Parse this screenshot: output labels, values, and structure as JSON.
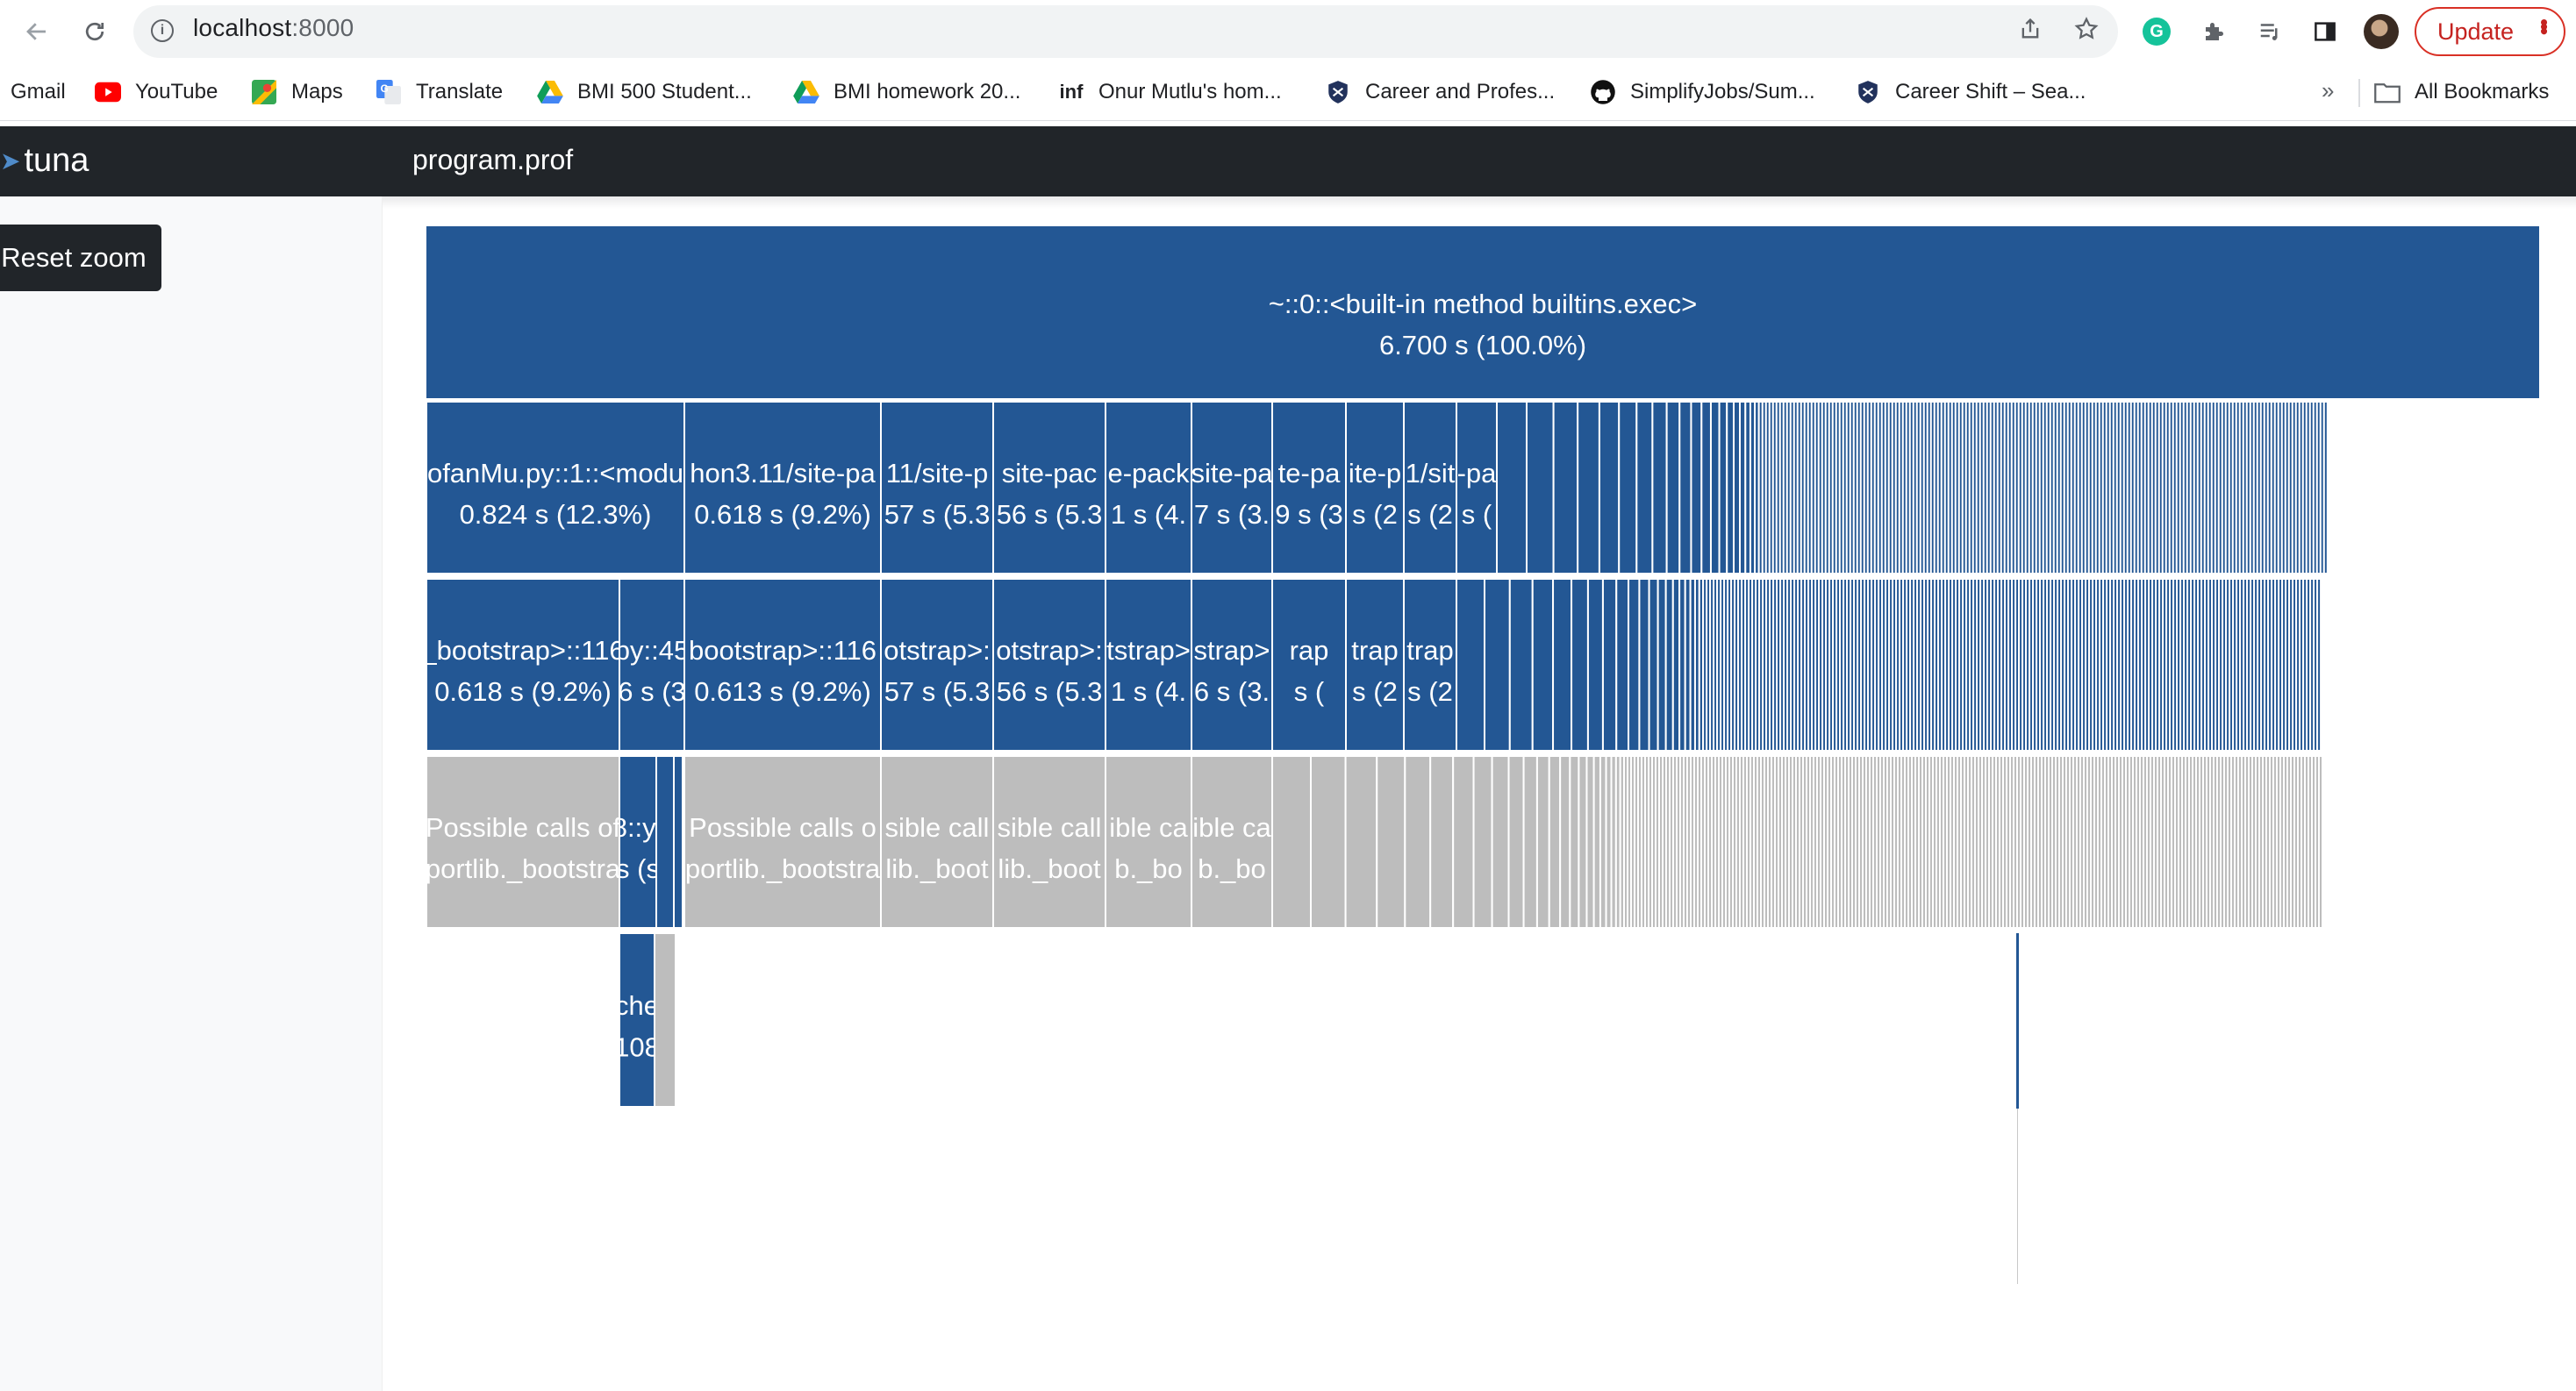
{
  "browser": {
    "url_host": "localhost",
    "url_port": ":8000",
    "update_label": "Update",
    "bookmarks": [
      {
        "label": "Gmail",
        "icon": "gmail-icon"
      },
      {
        "label": "YouTube",
        "icon": "youtube-icon"
      },
      {
        "label": "Maps",
        "icon": "maps-icon"
      },
      {
        "label": "Translate",
        "icon": "translate-icon"
      },
      {
        "label": "BMI 500 Student...",
        "icon": "google-drive-icon"
      },
      {
        "label": "BMI homework 20...",
        "icon": "google-drive-icon"
      },
      {
        "label": "Onur Mutlu's hom...",
        "icon": "inf-icon"
      },
      {
        "label": "Career and Profes...",
        "icon": "shield-icon"
      },
      {
        "label": "SimplifyJobs/Sum...",
        "icon": "github-icon"
      },
      {
        "label": "Career Shift – Sea...",
        "icon": "shield-icon"
      }
    ],
    "all_bookmarks_label": "All Bookmarks"
  },
  "app": {
    "name": "tuna",
    "file": "program.prof",
    "reset_zoom_label": "Reset zoom"
  },
  "colors": {
    "block": "#235794",
    "no_data": "#bdbdbd",
    "header": "#212529"
  },
  "flame": {
    "root": {
      "name": "~::0::<built-in method builtins.exec>",
      "stat": "6.700 s (100.0%)"
    },
    "level1": [
      {
        "name": "ofanMu.py::1::<modu",
        "stat": "0.824 s (12.3%)"
      },
      {
        "name": "hon3.11/site-pa",
        "stat": "0.618 s (9.2%)"
      },
      {
        "name": "11/site-p",
        "stat": "57 s (5.3"
      },
      {
        "name": "site-pac",
        "stat": "56 s (5.3"
      },
      {
        "name": "e-pack",
        "stat": "1 s (4."
      },
      {
        "name": "site-pa",
        "stat": "7 s (3."
      },
      {
        "name": "te-pa",
        "stat": "9 s (3"
      },
      {
        "name": "ite-p",
        "stat": "s (2"
      },
      {
        "name": "1/sit",
        "stat": "s (2"
      },
      {
        "name": "-pa",
        "stat": "s ("
      }
    ],
    "level2": [
      {
        "name": "_bootstrap>::116",
        "stat": "0.618 s (9.2%)"
      },
      {
        "name": "py::45",
        "stat": "6 s (3"
      },
      {
        "name": "bootstrap>::116",
        "stat": "0.613 s (9.2%)"
      },
      {
        "name": "otstrap>:",
        "stat": "57 s (5.3"
      },
      {
        "name": "otstrap>:",
        "stat": "56 s (5.3"
      },
      {
        "name": "tstrap>",
        "stat": "1 s (4."
      },
      {
        "name": "strap>",
        "stat": "6 s (3."
      },
      {
        "name": "rap",
        "stat": "s ("
      },
      {
        "name": "trap",
        "stat": "s (2"
      },
      {
        "name": "trap",
        "stat": "s (2"
      }
    ],
    "level3": [
      {
        "name": "Possible calls of",
        "stat": "portlib._bootstra"
      },
      {
        "name": "8::yt",
        "stat": "s (s"
      },
      {
        "name": "Possible calls o",
        "stat": "portlib._bootstra"
      },
      {
        "name": "sible call",
        "stat": "lib._boot"
      },
      {
        "name": "sible call",
        "stat": "lib._boot"
      },
      {
        "name": "ible ca",
        "stat": "b._bo"
      },
      {
        "name": "ible ca",
        "stat": "b._bo"
      }
    ],
    "level4": [
      {
        "name": "che",
        "stat": "108"
      }
    ]
  }
}
